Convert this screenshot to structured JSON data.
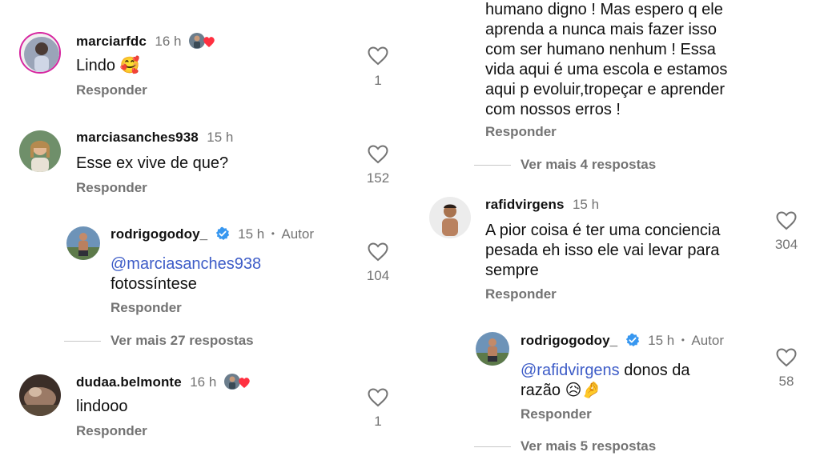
{
  "left": {
    "c1": {
      "user": "marciarfdc",
      "time": "16 h",
      "text": "Lindo 🥰",
      "reply": "Responder",
      "likes": "1"
    },
    "c2": {
      "user": "marciasanches938",
      "time": "15 h",
      "text": "Esse ex vive de que?",
      "reply": "Responder",
      "likes": "152"
    },
    "r1": {
      "user": "rodrigogodoy_",
      "time": "15 h",
      "sep": "•",
      "author": "Autor",
      "mention": "@marciasanches938",
      "text": "fotossíntese",
      "reply": "Responder",
      "likes": "104"
    },
    "more1": "Ver mais 27 respostas",
    "c3": {
      "user": "dudaa.belmonte",
      "time": "16 h",
      "text": "lindooo",
      "reply": "Responder",
      "likes": "1"
    }
  },
  "right": {
    "c0_lines": [
      "humano digno ! Mas espero q ele",
      "aprenda a nunca mais fazer isso",
      "com ser humano nenhum ! Essa",
      "vida aqui é uma escola e estamos",
      "aqui p evoluir,tropeçar e aprender",
      "com nossos erros !"
    ],
    "c0_reply": "Responder",
    "more0": "Ver mais 4 respostas",
    "c1": {
      "user": "rafidvirgens",
      "time": "15 h",
      "lines": [
        "A pior coisa é ter uma conciencia",
        "pesada eh isso ele vai levar para",
        "sempre"
      ],
      "reply": "Responder",
      "likes": "304"
    },
    "r1": {
      "user": "rodrigogodoy_",
      "time": "15 h",
      "sep": "•",
      "author": "Autor",
      "mention": "@rafidvirgens",
      "text": " donos da",
      "text2": "razão 😥🤌",
      "reply": "Responder",
      "likes": "58"
    },
    "more1": "Ver mais 5 respostas"
  },
  "colors": {
    "verified": "#3797f0",
    "mention": "#3d5cc7",
    "muted": "#737373",
    "heart_react": "#ff3040"
  }
}
